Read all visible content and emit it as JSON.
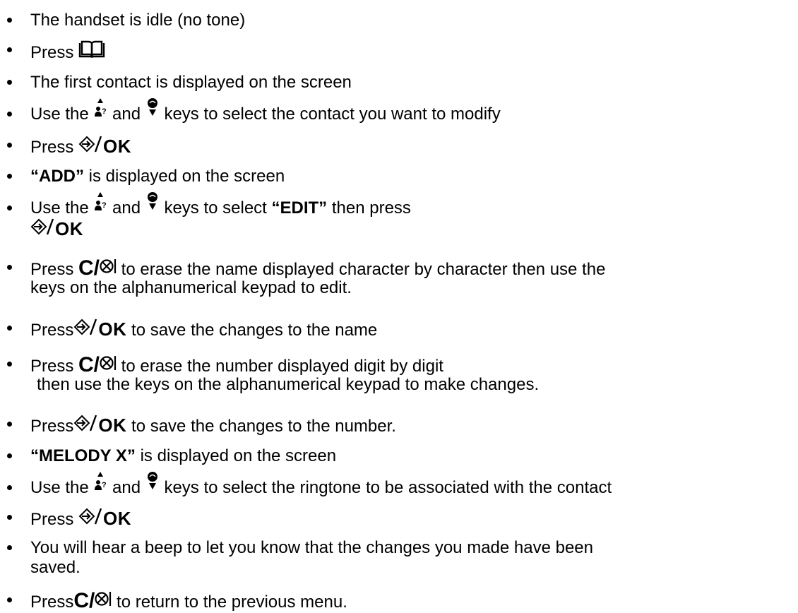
{
  "steps": [
    {
      "text": "The handset is idle (no tone)"
    },
    {
      "pre": "Press ",
      "icon": "phonebook-icon"
    },
    {
      "text": "The first contact is displayed on the screen"
    },
    {
      "pre": "Use the ",
      "mid": " and ",
      "post": " keys to select the contact you want to modify"
    },
    {
      "pre": "Press ",
      "ok": "OK"
    },
    {
      "bold": "“ADD”",
      "post": " is displayed on the screen"
    },
    {
      "pre": "Use the ",
      "mid": " and ",
      "post": " keys to select ",
      "bold": "“EDIT”",
      "post2": " then press",
      "ok": "OK"
    },
    {
      "pre": "Press ",
      "ckey": "C/",
      "post": " to erase the name displayed character by character then use the",
      "line2": "keys on the alphanumerical keypad to edit."
    },
    {
      "pre": "Press",
      "ok": "OK",
      "post": " to save the changes to the name"
    },
    {
      "pre": "Press ",
      "ckey": "C/",
      "post": " to erase the number displayed digit by digit",
      "line2": "then use the keys on the alphanumerical keypad to make changes."
    },
    {
      "pre": "Press",
      "ok": "OK",
      "post": " to save the changes to the number."
    },
    {
      "bold": "“MELODY X”",
      "post": " is displayed on the screen"
    },
    {
      "pre": "Use the ",
      "mid": " and ",
      "post": " keys to select the ringtone to be associated with the contact"
    },
    {
      "pre": "Press ",
      "ok": "OK"
    },
    {
      "text": "You will hear a beep to let you know that the changes you made have been",
      "line2": "saved."
    },
    {
      "pre": "Press",
      "ckey": "C/",
      "post": " to return to the previous menu."
    }
  ]
}
